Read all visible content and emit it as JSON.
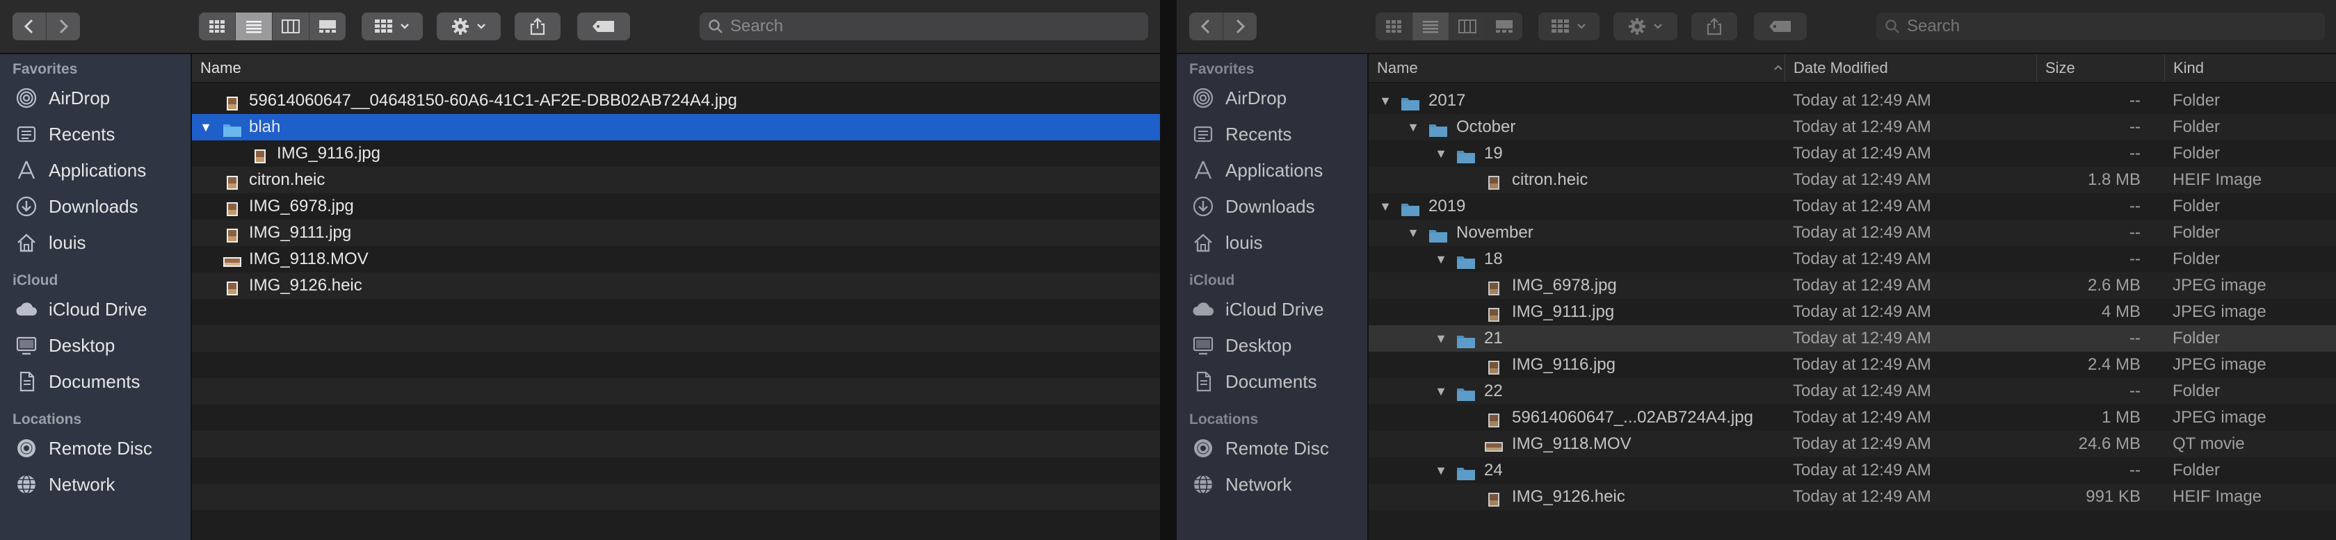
{
  "toolbar": {
    "search_placeholder": "Search"
  },
  "sidebar": {
    "sections": [
      {
        "heading": "Favorites",
        "items": [
          {
            "label": "AirDrop",
            "icon": "airdrop-icon"
          },
          {
            "label": "Recents",
            "icon": "recents-icon"
          },
          {
            "label": "Applications",
            "icon": "applications-icon"
          },
          {
            "label": "Downloads",
            "icon": "downloads-icon"
          },
          {
            "label": "louis",
            "icon": "home-icon"
          }
        ]
      },
      {
        "heading": "iCloud",
        "items": [
          {
            "label": "iCloud Drive",
            "icon": "cloud-icon"
          },
          {
            "label": "Desktop",
            "icon": "desktop-icon"
          },
          {
            "label": "Documents",
            "icon": "documents-icon"
          }
        ]
      },
      {
        "heading": "Locations",
        "items": [
          {
            "label": "Remote Disc",
            "icon": "disc-icon"
          },
          {
            "label": "Network",
            "icon": "network-icon"
          }
        ]
      }
    ]
  },
  "left_window": {
    "column_name": "Name",
    "rows": [
      {
        "name": "59614060647__04648150-60A6-41C1-AF2E-DBB02AB724A4.jpg",
        "icon": "image-file-icon",
        "depth": 0
      },
      {
        "name": "blah",
        "icon": "folder-icon",
        "depth": 0,
        "expanded": true,
        "selected": true
      },
      {
        "name": "IMG_9116.jpg",
        "icon": "image-file-icon",
        "depth": 1
      },
      {
        "name": "citron.heic",
        "icon": "image-file-icon",
        "depth": 0
      },
      {
        "name": "IMG_6978.jpg",
        "icon": "image-file-icon",
        "depth": 0
      },
      {
        "name": "IMG_9111.jpg",
        "icon": "image-file-icon",
        "depth": 0
      },
      {
        "name": "IMG_9118.MOV",
        "icon": "movie-file-icon",
        "depth": 0
      },
      {
        "name": "IMG_9126.heic",
        "icon": "image-file-icon",
        "depth": 0
      }
    ]
  },
  "right_window": {
    "columns": {
      "name": "Name",
      "date": "Date Modified",
      "size": "Size",
      "kind": "Kind"
    },
    "rows": [
      {
        "name": "2017",
        "icon": "folder-icon",
        "depth": 0,
        "expanded": true,
        "date": "Today at 12:49 AM",
        "size": "--",
        "kind": "Folder"
      },
      {
        "name": "October",
        "icon": "folder-icon",
        "depth": 1,
        "expanded": true,
        "date": "Today at 12:49 AM",
        "size": "--",
        "kind": "Folder"
      },
      {
        "name": "19",
        "icon": "folder-icon",
        "depth": 2,
        "expanded": true,
        "date": "Today at 12:49 AM",
        "size": "--",
        "kind": "Folder"
      },
      {
        "name": "citron.heic",
        "icon": "image-file-icon",
        "depth": 3,
        "date": "Today at 12:49 AM",
        "size": "1.8 MB",
        "kind": "HEIF Image"
      },
      {
        "name": "2019",
        "icon": "folder-icon",
        "depth": 0,
        "expanded": true,
        "date": "Today at 12:49 AM",
        "size": "--",
        "kind": "Folder"
      },
      {
        "name": "November",
        "icon": "folder-icon",
        "depth": 1,
        "expanded": true,
        "date": "Today at 12:49 AM",
        "size": "--",
        "kind": "Folder"
      },
      {
        "name": "18",
        "icon": "folder-icon",
        "depth": 2,
        "expanded": true,
        "date": "Today at 12:49 AM",
        "size": "--",
        "kind": "Folder"
      },
      {
        "name": "IMG_6978.jpg",
        "icon": "image-file-icon",
        "depth": 3,
        "date": "Today at 12:49 AM",
        "size": "2.6 MB",
        "kind": "JPEG image"
      },
      {
        "name": "IMG_9111.jpg",
        "icon": "image-file-icon",
        "depth": 3,
        "date": "Today at 12:49 AM",
        "size": "4 MB",
        "kind": "JPEG image"
      },
      {
        "name": "21",
        "icon": "folder-icon",
        "depth": 2,
        "expanded": true,
        "highlighted": true,
        "date": "Today at 12:49 AM",
        "size": "--",
        "kind": "Folder"
      },
      {
        "name": "IMG_9116.jpg",
        "icon": "image-file-icon",
        "depth": 3,
        "date": "Today at 12:49 AM",
        "size": "2.4 MB",
        "kind": "JPEG image"
      },
      {
        "name": "22",
        "icon": "folder-icon",
        "depth": 2,
        "expanded": true,
        "date": "Today at 12:49 AM",
        "size": "--",
        "kind": "Folder"
      },
      {
        "name": "59614060647_...02AB724A4.jpg",
        "icon": "image-file-icon",
        "depth": 3,
        "date": "Today at 12:49 AM",
        "size": "1 MB",
        "kind": "JPEG image"
      },
      {
        "name": "IMG_9118.MOV",
        "icon": "movie-file-icon",
        "depth": 3,
        "date": "Today at 12:49 AM",
        "size": "24.6 MB",
        "kind": "QT movie"
      },
      {
        "name": "24",
        "icon": "folder-icon",
        "depth": 2,
        "expanded": true,
        "date": "Today at 12:49 AM",
        "size": "--",
        "kind": "Folder"
      },
      {
        "name": "IMG_9126.heic",
        "icon": "image-file-icon",
        "depth": 3,
        "date": "Today at 12:49 AM",
        "size": "991 KB",
        "kind": "HEIF Image"
      }
    ]
  }
}
